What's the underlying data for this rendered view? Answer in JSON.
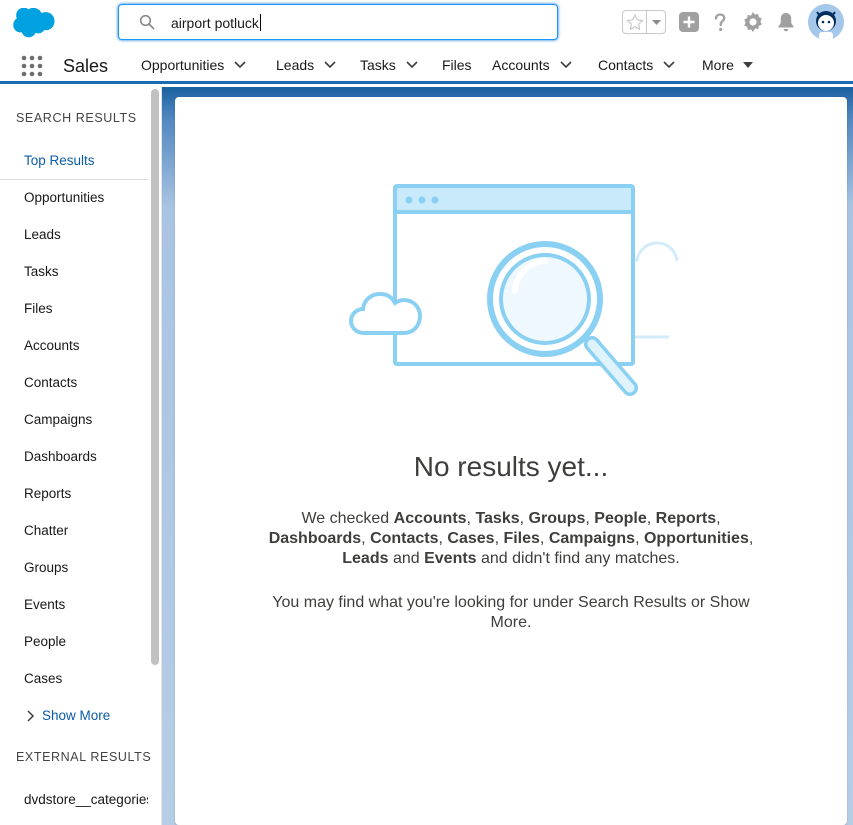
{
  "header": {
    "search": {
      "value": "airport potluck"
    }
  },
  "nav": {
    "app_name": "Sales",
    "items": [
      {
        "label": "Opportunities",
        "has_menu": true
      },
      {
        "label": "Leads",
        "has_menu": true
      },
      {
        "label": "Tasks",
        "has_menu": true
      },
      {
        "label": "Files",
        "has_menu": false
      },
      {
        "label": "Accounts",
        "has_menu": true
      },
      {
        "label": "Contacts",
        "has_menu": true
      },
      {
        "label": "More",
        "has_menu": true
      }
    ]
  },
  "sidebar": {
    "search_results_heading": "SEARCH RESULTS",
    "items": [
      {
        "label": "Top Results",
        "active": true
      },
      {
        "label": "Opportunities"
      },
      {
        "label": "Leads"
      },
      {
        "label": "Tasks"
      },
      {
        "label": "Files"
      },
      {
        "label": "Accounts"
      },
      {
        "label": "Contacts"
      },
      {
        "label": "Campaigns"
      },
      {
        "label": "Dashboards"
      },
      {
        "label": "Reports"
      },
      {
        "label": "Chatter"
      },
      {
        "label": "Groups"
      },
      {
        "label": "Events"
      },
      {
        "label": "People"
      },
      {
        "label": "Cases"
      }
    ],
    "show_more": "Show More",
    "external_heading": "EXTERNAL RESULTS",
    "external_items": [
      {
        "label": "dvdstore__categories"
      }
    ]
  },
  "main": {
    "empty_title": "No results yet...",
    "message": {
      "prefix": "We checked ",
      "objects": [
        "Accounts",
        "Tasks",
        "Groups",
        "People",
        "Reports",
        "Dashboards",
        "Contacts",
        "Cases",
        "Files",
        "Campaigns",
        "Opportunities",
        "Leads",
        "Events"
      ],
      "sep": ", ",
      "and": " and ",
      "suffix": " and didn't find any matches."
    },
    "hint": "You may find what you're looking for under Search Results or Show More."
  },
  "colors": {
    "brand_blue": "#0b5cab",
    "header_band": "#1b6bb4",
    "illustration_stroke": "#8ad0f2"
  }
}
